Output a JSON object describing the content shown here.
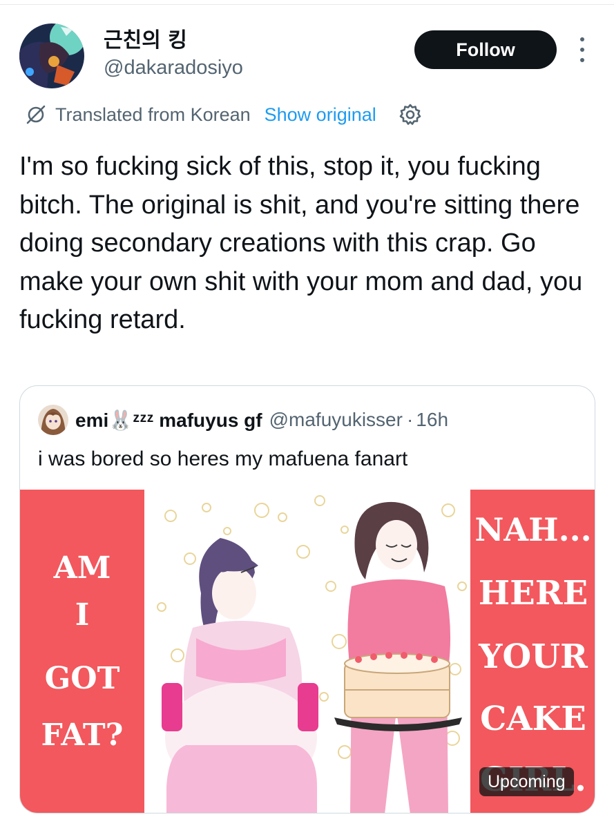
{
  "tweet": {
    "display_name": "근친의 킹",
    "handle": "@dakaradosiyo",
    "follow_label": "Follow",
    "translated_label": "Translated from Korean",
    "show_original_label": "Show original",
    "text": "I'm so fucking sick of this, stop it, you fucking bitch. The original is shit, and you're sitting there doing secondary creations with this crap. Go make your own shit with your mom and dad, you fucking retard."
  },
  "quote": {
    "display_name": "emi🐰ᶻᶻᶻ mafuyus gf",
    "handle": "@mafuyukisser",
    "separator": "·",
    "time": "16h",
    "text": "i was bored so heres my mafuena fanart",
    "media": {
      "left_caption": [
        "AM",
        "I",
        "GOT",
        "FAT?"
      ],
      "right_caption": [
        "NAH...",
        "HERE",
        "YOUR",
        "CAKE",
        "GIRL."
      ],
      "badge": "Upcoming"
    }
  },
  "colors": {
    "accent_blue": "#1d9bf0",
    "follow_bg": "#0f1419",
    "secondary_text": "#536471",
    "panel_red": "#f2585d"
  },
  "icons": {
    "translate": "translate-slash-icon",
    "settings": "gear-icon",
    "more": "more-vertical-icon"
  }
}
